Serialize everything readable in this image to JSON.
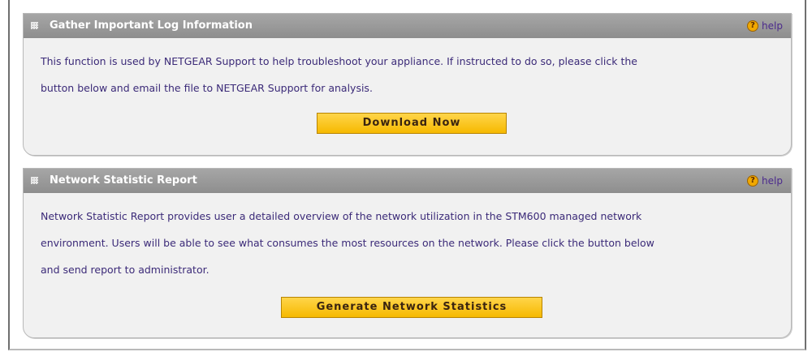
{
  "sections": {
    "log": {
      "title": "Gather Important Log Information",
      "help_label": "help",
      "description_line1": "This function is used by NETGEAR Support to help troubleshoot your appliance. If instructed to do so, please click the",
      "description_line2": "button below and email the file to NETGEAR Support for analysis.",
      "button_label": "Download Now"
    },
    "network": {
      "title": "Network Statistic Report",
      "help_label": "help",
      "description_line1": "Network Statistic Report provides user a detailed overview of the network utilization in the STM600 managed network",
      "description_line2": "environment. Users will be able to see what consumes the most resources on the network. Please click the button below",
      "description_line3": "and send report to administrator.",
      "button_label": "Generate Network Statistics"
    }
  },
  "colors": {
    "header_gray": "#9a9a9a",
    "panel_bg": "#f1f1f1",
    "text_purple": "#3b2a78",
    "button_yellow": "#f6b900",
    "help_orange": "#f0a800"
  },
  "icons": {
    "grip": "grip-icon",
    "help": "help-icon"
  }
}
